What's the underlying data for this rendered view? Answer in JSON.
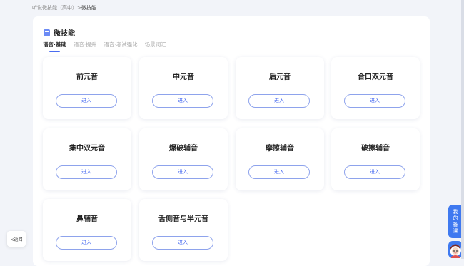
{
  "breadcrumb": {
    "parent": "听说微技能（高中）>",
    "current": "微技能"
  },
  "panel": {
    "title": "微技能"
  },
  "tabs": [
    {
      "label": "语音·基础",
      "active": true
    },
    {
      "label": "语音·提升",
      "active": false
    },
    {
      "label": "语音·考试强化",
      "active": false
    },
    {
      "label": "场景词汇",
      "active": false
    }
  ],
  "cards": [
    {
      "title": "前元音",
      "button": "进入"
    },
    {
      "title": "中元音",
      "button": "进入"
    },
    {
      "title": "后元音",
      "button": "进入"
    },
    {
      "title": "合口双元音",
      "button": "进入"
    },
    {
      "title": "集中双元音",
      "button": "进入"
    },
    {
      "title": "爆破辅音",
      "button": "进入"
    },
    {
      "title": "摩擦辅音",
      "button": "进入"
    },
    {
      "title": "破擦辅音",
      "button": "进入"
    },
    {
      "title": "鼻辅音",
      "button": "进入"
    },
    {
      "title": "舌侧音与半元音",
      "button": "进入"
    }
  ],
  "back_button": {
    "label": "<返回"
  },
  "side_tab": {
    "lines": [
      "我",
      "的",
      "备",
      "课"
    ]
  },
  "colors": {
    "accent": "#4a6cf0",
    "side_tab": "#3f79f0",
    "background": "#f2f4f9"
  },
  "icons": {
    "panel_icon": "document-icon",
    "assistant": "avatar-icon"
  }
}
